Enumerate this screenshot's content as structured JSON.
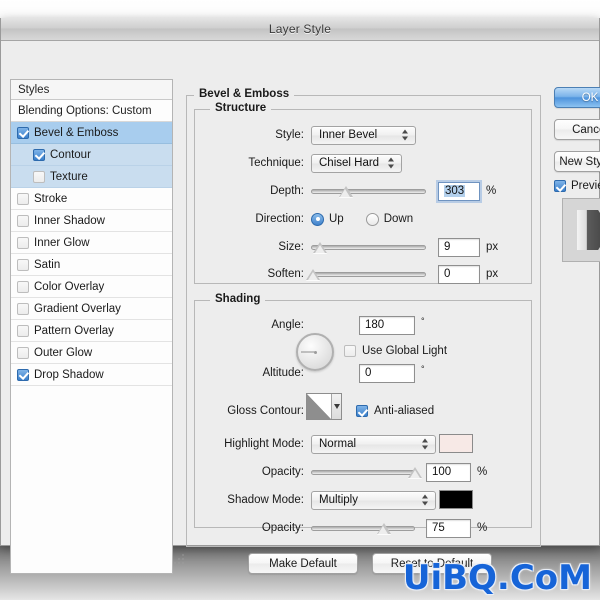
{
  "window": {
    "title": "Layer Style"
  },
  "styles_panel": {
    "header": "Styles",
    "blending_options": "Blending Options: Custom",
    "items": [
      {
        "label": "Bevel & Emboss",
        "checked": true,
        "selected": true,
        "indent": false
      },
      {
        "label": "Contour",
        "checked": true,
        "selected": false,
        "indent": true
      },
      {
        "label": "Texture",
        "checked": false,
        "selected": false,
        "indent": true
      },
      {
        "label": "Stroke",
        "checked": false,
        "selected": false,
        "indent": false
      },
      {
        "label": "Inner Shadow",
        "checked": false,
        "selected": false,
        "indent": false
      },
      {
        "label": "Inner Glow",
        "checked": false,
        "selected": false,
        "indent": false
      },
      {
        "label": "Satin",
        "checked": false,
        "selected": false,
        "indent": false
      },
      {
        "label": "Color Overlay",
        "checked": false,
        "selected": false,
        "indent": false
      },
      {
        "label": "Gradient Overlay",
        "checked": false,
        "selected": false,
        "indent": false
      },
      {
        "label": "Pattern Overlay",
        "checked": false,
        "selected": false,
        "indent": false
      },
      {
        "label": "Outer Glow",
        "checked": false,
        "selected": false,
        "indent": false
      },
      {
        "label": "Drop Shadow",
        "checked": true,
        "selected": false,
        "indent": false
      }
    ]
  },
  "effect": {
    "group_title": "Bevel & Emboss",
    "structure": {
      "title": "Structure",
      "style_label": "Style:",
      "style_value": "Inner Bevel",
      "technique_label": "Technique:",
      "technique_value": "Chisel Hard",
      "depth_label": "Depth:",
      "depth_value": "303",
      "depth_unit": "%",
      "depth_slider_pct": 30,
      "direction_label": "Direction:",
      "direction_up": "Up",
      "direction_down": "Down",
      "direction_selected": "Up",
      "size_label": "Size:",
      "size_value": "9",
      "size_unit": "px",
      "size_slider_pct": 8,
      "soften_label": "Soften:",
      "soften_value": "0",
      "soften_unit": "px",
      "soften_slider_pct": 2
    },
    "shading": {
      "title": "Shading",
      "angle_label": "Angle:",
      "angle_value": "180",
      "angle_unit": "°",
      "use_global_light": "Use Global Light",
      "use_global_light_checked": false,
      "altitude_label": "Altitude:",
      "altitude_value": "0",
      "altitude_unit": "°",
      "gloss_contour_label": "Gloss Contour:",
      "anti_aliased": "Anti-aliased",
      "anti_aliased_checked": true,
      "highlight_mode_label": "Highlight Mode:",
      "highlight_mode_value": "Normal",
      "highlight_color": "#f7e9e6",
      "highlight_opacity_label": "Opacity:",
      "highlight_opacity_value": "100",
      "highlight_opacity_unit": "%",
      "highlight_opacity_pct": 100,
      "shadow_mode_label": "Shadow Mode:",
      "shadow_mode_value": "Multiply",
      "shadow_color": "#000000",
      "shadow_opacity_label": "Opacity:",
      "shadow_opacity_value": "75",
      "shadow_opacity_unit": "%",
      "shadow_opacity_pct": 70
    },
    "make_default": "Make Default",
    "reset_to_default": "Reset to Default"
  },
  "actions": {
    "ok": "OK",
    "cancel": "Cancel",
    "new_style": "New Style...",
    "preview": "Preview",
    "preview_checked": true
  },
  "watermark": {
    "text": "UiBQ.CoM",
    "color": "#1664d8"
  }
}
